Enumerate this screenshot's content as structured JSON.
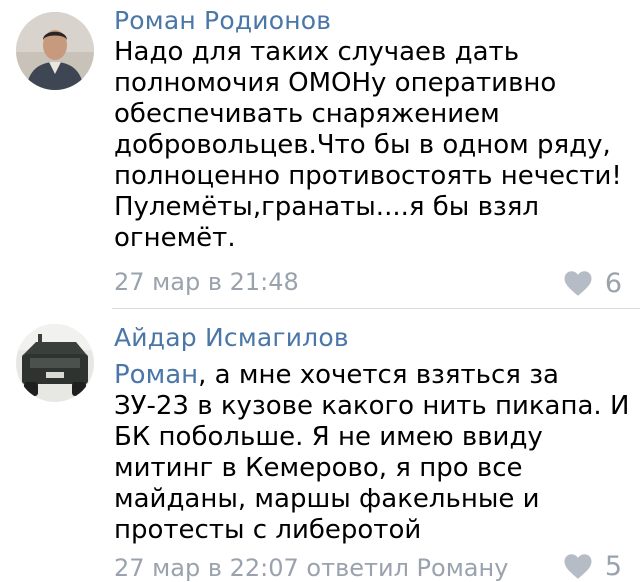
{
  "comments": [
    {
      "author": "Роман Родионов",
      "text_lines": [
        "Надо для таких случаев дать",
        "полномочия ОМОНу оперативно",
        "обеспечивать снаряжением",
        "добровольцев.Что бы в одном ряду,",
        "полноценно противостоять нечести!",
        "Пулемёты,гранаты....я бы взял",
        "огнемёт."
      ],
      "timestamp": "27 мар в 21:48",
      "likes": "6",
      "like_icon": "heart-icon"
    },
    {
      "author": "Айдар Исмагилов",
      "mention": "Роман",
      "first_line_rest": ", а мне хочется взяться за",
      "text_lines": [
        "ЗУ-23 в кузове какого нить пикапа. И",
        "БК побольше. Я не имею ввиду",
        "митинг в Кемерово, я про все",
        "майданы, маршы факельные и",
        "протесты с либеротой"
      ],
      "timestamp": "27 мар в 22:07 ответил Роману",
      "likes": "5",
      "like_icon": "heart-icon"
    }
  ],
  "colors": {
    "author": "#4a76a8",
    "meta": "#9aa3ad",
    "divider": "#d8dbe0"
  }
}
